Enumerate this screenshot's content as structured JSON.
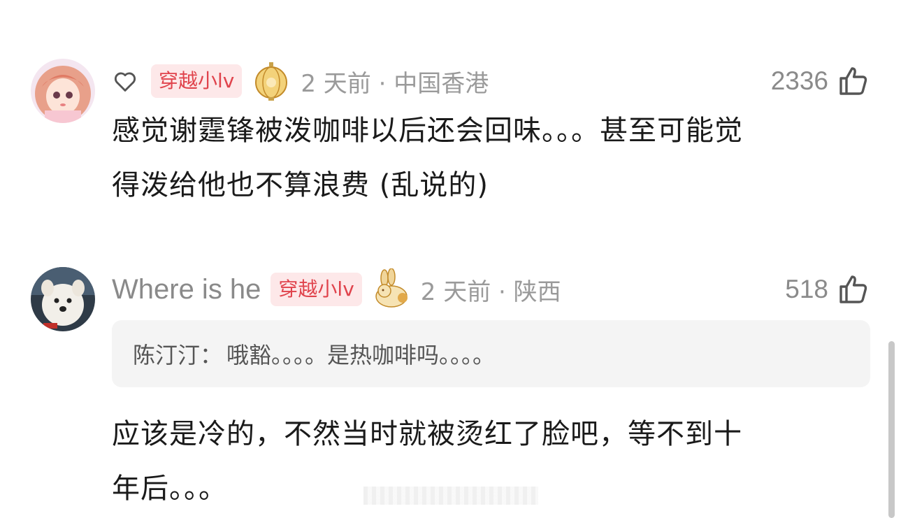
{
  "comments": [
    {
      "username": "",
      "badge": "穿越小lv",
      "time_location": "2 天前 · 中国香港",
      "likes": "2336",
      "lines": [
        "感觉谢霆锋被泼咖啡以后还会回味。。。甚至可能觉",
        "得泼给他也不算浪费 (乱说的)"
      ]
    },
    {
      "username": "Where is he",
      "badge": "穿越小lv",
      "time_location": "2 天前 · 陕西",
      "likes": "518",
      "quote": {
        "author": "陈汀汀：",
        "text": "哦豁。。。。是热咖啡吗。。。。"
      },
      "lines": [
        "应该是冷的，不然当时就被烫红了脸吧，等不到十",
        "年后。。。"
      ]
    }
  ],
  "colors": {
    "badge_bg": "#fde8e9",
    "badge_text": "#e0434c",
    "meta_gray": "#9a9a9a",
    "body_text": "#1a1a1a",
    "quote_bg": "#f4f4f4"
  }
}
